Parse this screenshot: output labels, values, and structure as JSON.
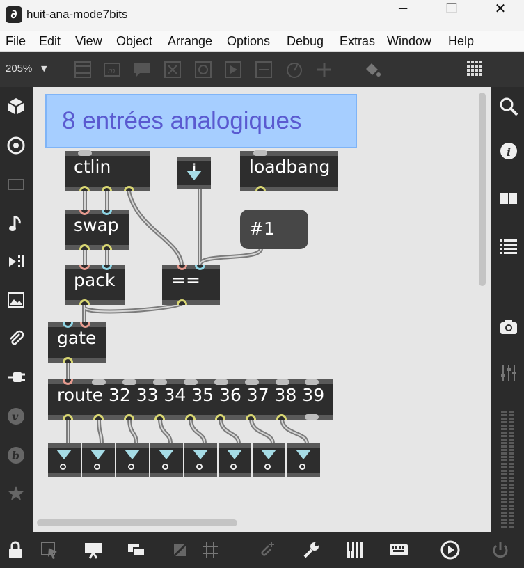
{
  "window": {
    "title": "huit-ana-mode7bits",
    "app_icon": "max-logo-icon",
    "controls": [
      "─",
      "☐",
      "✕"
    ]
  },
  "menu": [
    "File",
    "Edit",
    "View",
    "Object",
    "Arrange",
    "Options",
    "Debug",
    "Extras",
    "Window",
    "Help"
  ],
  "toolbar": {
    "zoom": "205%",
    "zoom_caret": "▼"
  },
  "patch": {
    "comment": "8 entrées analogiques",
    "objects": {
      "ctlin": "ctlin",
      "loadbang": "loadbang",
      "swap": "swap",
      "pack": "pack",
      "equals": "==",
      "gate": "gate",
      "route": "route 32 33 34 35 36 37 38 39"
    },
    "message": "#1",
    "int_box_label": "i",
    "number_boxes": 8
  },
  "colors": {
    "canvas": "#e6e6e6",
    "object": "#2d2d2d",
    "comment_bg": "#a6ceff",
    "comment_text": "#5a5ad0",
    "cable": "#8a8a8a",
    "inlet_left": "#e79b8f",
    "inlet_right": "#8fd6e6",
    "outlet": "#d8d672"
  }
}
